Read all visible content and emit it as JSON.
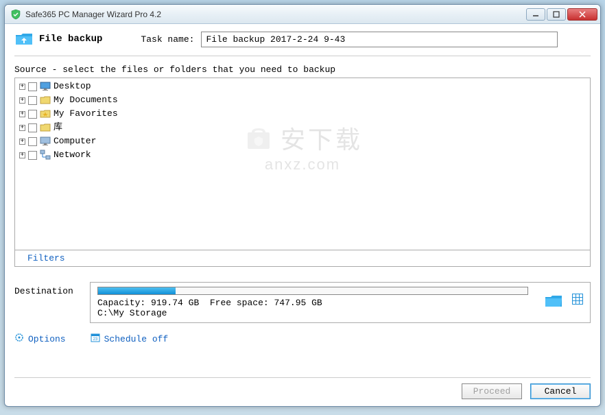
{
  "window": {
    "title": "Safe365 PC Manager Wizard Pro 4.2"
  },
  "header": {
    "page_title": "File backup",
    "task_label": "Task name:",
    "task_value": "File backup 2017-2-24 9-43"
  },
  "source": {
    "label": "Source - select the files or folders that you need to backup",
    "items": [
      {
        "label": "Desktop",
        "icon": "desktop"
      },
      {
        "label": "My Documents",
        "icon": "folder"
      },
      {
        "label": "My Favorites",
        "icon": "favorites"
      },
      {
        "label": "库",
        "icon": "library"
      },
      {
        "label": "Computer",
        "icon": "computer"
      },
      {
        "label": "Network",
        "icon": "network"
      }
    ]
  },
  "filters": {
    "label": "Filters"
  },
  "destination": {
    "label": "Destination",
    "capacity_label": "Capacity:",
    "capacity_value": "919.74 GB",
    "free_label": "Free space:",
    "free_value": "747.95 GB",
    "path": "C:\\My Storage"
  },
  "bottom": {
    "options": "Options",
    "schedule": "Schedule off"
  },
  "footer": {
    "proceed": "Proceed",
    "cancel": "Cancel"
  },
  "watermark": {
    "top": "安下载",
    "bottom": "anxz.com"
  }
}
